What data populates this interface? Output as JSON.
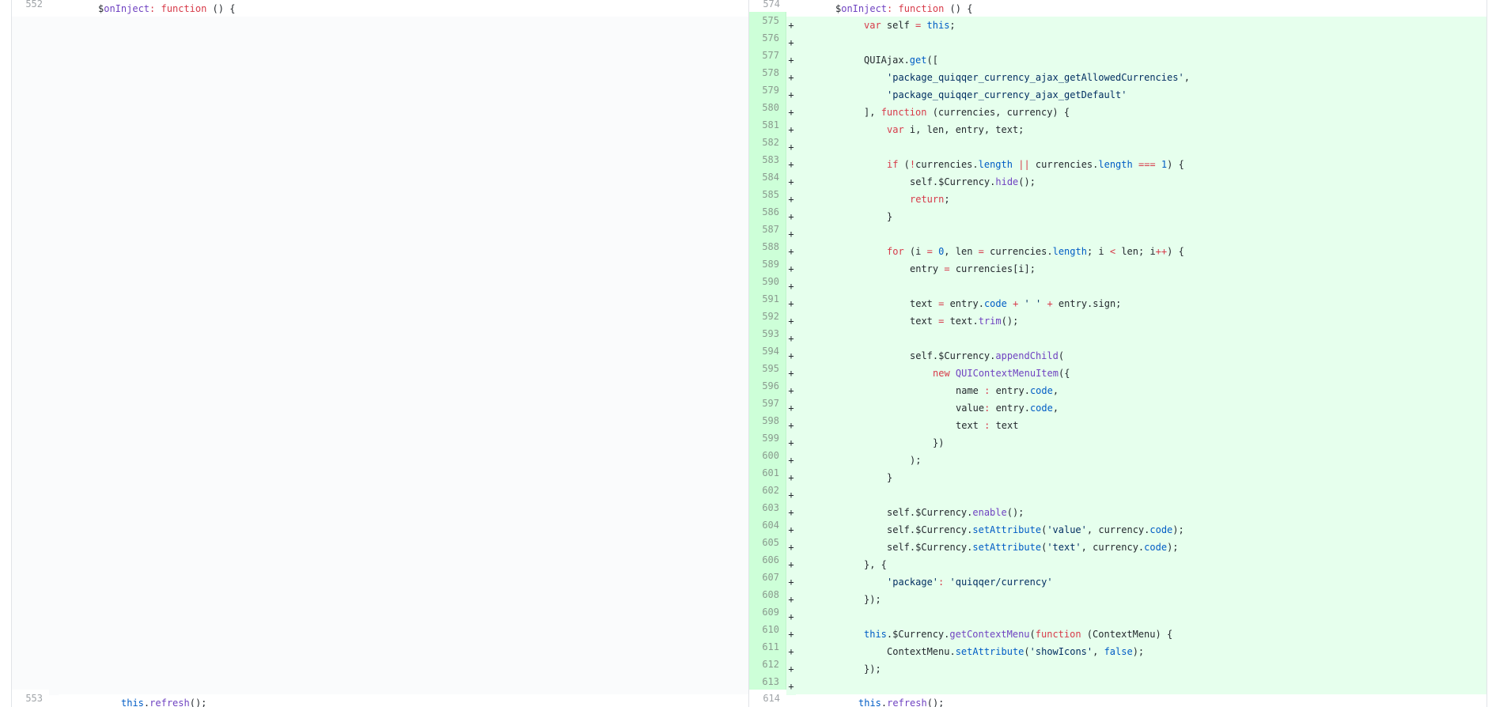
{
  "left": {
    "header": {
      "num": "552",
      "code": [
        [
          "",
          "$"
        ],
        [
          "f",
          "onInject"
        ],
        [
          "k",
          ":"
        ],
        [
          "",
          " "
        ],
        [
          "k",
          "function"
        ],
        [
          "",
          " () {"
        ]
      ]
    },
    "footer": {
      "num": "553",
      "code": [
        [
          "c",
          "this"
        ],
        [
          "",
          "."
        ],
        [
          "f",
          "refresh"
        ],
        [
          "",
          "();"
        ]
      ]
    }
  },
  "right": {
    "header": {
      "num": "574",
      "code": [
        [
          "",
          "$"
        ],
        [
          "f",
          "onInject"
        ],
        [
          "k",
          ":"
        ],
        [
          "",
          " "
        ],
        [
          "k",
          "function"
        ],
        [
          "",
          " () {"
        ]
      ]
    },
    "footer": {
      "num": "614",
      "code": [
        [
          "c",
          "this"
        ],
        [
          "",
          "."
        ],
        [
          "f",
          "refresh"
        ],
        [
          "",
          "();"
        ]
      ]
    },
    "lines": [
      {
        "num": "575",
        "indent": 2,
        "code": [
          [
            "k",
            "var"
          ],
          [
            "",
            " self "
          ],
          [
            "k",
            "="
          ],
          [
            "",
            " "
          ],
          [
            "c",
            "this"
          ],
          [
            "",
            ";"
          ]
        ]
      },
      {
        "num": "576",
        "indent": 0,
        "code": []
      },
      {
        "num": "577",
        "indent": 2,
        "code": [
          [
            "",
            "QUIAjax."
          ],
          [
            "c",
            "get"
          ],
          [
            "",
            "(["
          ]
        ]
      },
      {
        "num": "578",
        "indent": 3,
        "code": [
          [
            "s",
            "'package_quiqqer_currency_ajax_getAllowedCurrencies'"
          ],
          [
            "",
            ","
          ]
        ]
      },
      {
        "num": "579",
        "indent": 3,
        "code": [
          [
            "s",
            "'package_quiqqer_currency_ajax_getDefault'"
          ]
        ]
      },
      {
        "num": "580",
        "indent": 2,
        "code": [
          [
            "",
            "], "
          ],
          [
            "k",
            "function"
          ],
          [
            "",
            " (currencies, currency) {"
          ]
        ]
      },
      {
        "num": "581",
        "indent": 3,
        "code": [
          [
            "k",
            "var"
          ],
          [
            "",
            " i, len, entry, text;"
          ]
        ]
      },
      {
        "num": "582",
        "indent": 0,
        "code": []
      },
      {
        "num": "583",
        "indent": 3,
        "code": [
          [
            "k",
            "if"
          ],
          [
            "",
            " ("
          ],
          [
            "k",
            "!"
          ],
          [
            "",
            "currencies."
          ],
          [
            "c",
            "length"
          ],
          [
            "",
            " "
          ],
          [
            "k",
            "||"
          ],
          [
            "",
            " currencies."
          ],
          [
            "c",
            "length"
          ],
          [
            "",
            " "
          ],
          [
            "k",
            "==="
          ],
          [
            "",
            " "
          ],
          [
            "c",
            "1"
          ],
          [
            "",
            ") {"
          ]
        ]
      },
      {
        "num": "584",
        "indent": 4,
        "code": [
          [
            "",
            "self.$Currency."
          ],
          [
            "f",
            "hide"
          ],
          [
            "",
            "();"
          ]
        ]
      },
      {
        "num": "585",
        "indent": 4,
        "code": [
          [
            "k",
            "return"
          ],
          [
            "",
            ";"
          ]
        ]
      },
      {
        "num": "586",
        "indent": 3,
        "code": [
          [
            "",
            "}"
          ]
        ]
      },
      {
        "num": "587",
        "indent": 0,
        "code": []
      },
      {
        "num": "588",
        "indent": 3,
        "code": [
          [
            "k",
            "for"
          ],
          [
            "",
            " (i "
          ],
          [
            "k",
            "="
          ],
          [
            "",
            " "
          ],
          [
            "c",
            "0"
          ],
          [
            "",
            ", len "
          ],
          [
            "k",
            "="
          ],
          [
            "",
            " currencies."
          ],
          [
            "c",
            "length"
          ],
          [
            "",
            "; i "
          ],
          [
            "k",
            "<"
          ],
          [
            "",
            " len; i"
          ],
          [
            "k",
            "++"
          ],
          [
            "",
            ") {"
          ]
        ]
      },
      {
        "num": "589",
        "indent": 4,
        "code": [
          [
            "",
            "entry "
          ],
          [
            "k",
            "="
          ],
          [
            "",
            " currencies[i];"
          ]
        ]
      },
      {
        "num": "590",
        "indent": 0,
        "code": []
      },
      {
        "num": "591",
        "indent": 4,
        "code": [
          [
            "",
            "text "
          ],
          [
            "k",
            "="
          ],
          [
            "",
            " entry."
          ],
          [
            "c",
            "code"
          ],
          [
            "",
            " "
          ],
          [
            "k",
            "+"
          ],
          [
            "",
            " "
          ],
          [
            "s",
            "' '"
          ],
          [
            "",
            " "
          ],
          [
            "k",
            "+"
          ],
          [
            "",
            " entry.sign;"
          ]
        ]
      },
      {
        "num": "592",
        "indent": 4,
        "code": [
          [
            "",
            "text "
          ],
          [
            "k",
            "="
          ],
          [
            "",
            " text."
          ],
          [
            "f",
            "trim"
          ],
          [
            "",
            "();"
          ]
        ]
      },
      {
        "num": "593",
        "indent": 0,
        "code": []
      },
      {
        "num": "594",
        "indent": 4,
        "code": [
          [
            "",
            "self.$Currency."
          ],
          [
            "f",
            "appendChild"
          ],
          [
            "",
            "("
          ]
        ]
      },
      {
        "num": "595",
        "indent": 5,
        "code": [
          [
            "k",
            "new"
          ],
          [
            "",
            " "
          ],
          [
            "f",
            "QUIContextMenuItem"
          ],
          [
            "",
            "({"
          ]
        ]
      },
      {
        "num": "596",
        "indent": 6,
        "code": [
          [
            "",
            "name "
          ],
          [
            "k",
            ":"
          ],
          [
            "",
            " entry."
          ],
          [
            "c",
            "code"
          ],
          [
            "",
            ","
          ]
        ]
      },
      {
        "num": "597",
        "indent": 6,
        "code": [
          [
            "",
            "value"
          ],
          [
            "k",
            ":"
          ],
          [
            "",
            " entry."
          ],
          [
            "c",
            "code"
          ],
          [
            "",
            ","
          ]
        ]
      },
      {
        "num": "598",
        "indent": 6,
        "code": [
          [
            "",
            "text "
          ],
          [
            "k",
            ":"
          ],
          [
            "",
            " text"
          ]
        ]
      },
      {
        "num": "599",
        "indent": 5,
        "code": [
          [
            "",
            "})"
          ]
        ]
      },
      {
        "num": "600",
        "indent": 4,
        "code": [
          [
            "",
            ");"
          ]
        ]
      },
      {
        "num": "601",
        "indent": 3,
        "code": [
          [
            "",
            "}"
          ]
        ]
      },
      {
        "num": "602",
        "indent": 0,
        "code": []
      },
      {
        "num": "603",
        "indent": 3,
        "code": [
          [
            "",
            "self.$Currency."
          ],
          [
            "f",
            "enable"
          ],
          [
            "",
            "();"
          ]
        ]
      },
      {
        "num": "604",
        "indent": 3,
        "code": [
          [
            "",
            "self.$Currency."
          ],
          [
            "c",
            "setAttribute"
          ],
          [
            "",
            "("
          ],
          [
            "s",
            "'value'"
          ],
          [
            "",
            ", currency."
          ],
          [
            "c",
            "code"
          ],
          [
            "",
            ");"
          ]
        ]
      },
      {
        "num": "605",
        "indent": 3,
        "code": [
          [
            "",
            "self.$Currency."
          ],
          [
            "c",
            "setAttribute"
          ],
          [
            "",
            "("
          ],
          [
            "s",
            "'text'"
          ],
          [
            "",
            ", currency."
          ],
          [
            "c",
            "code"
          ],
          [
            "",
            ");"
          ]
        ]
      },
      {
        "num": "606",
        "indent": 2,
        "code": [
          [
            "",
            "}, {"
          ]
        ]
      },
      {
        "num": "607",
        "indent": 3,
        "code": [
          [
            "s",
            "'package'"
          ],
          [
            "k",
            ":"
          ],
          [
            "",
            " "
          ],
          [
            "s",
            "'quiqqer/currency'"
          ]
        ]
      },
      {
        "num": "608",
        "indent": 2,
        "code": [
          [
            "",
            "});"
          ]
        ]
      },
      {
        "num": "609",
        "indent": 0,
        "code": []
      },
      {
        "num": "610",
        "indent": 2,
        "code": [
          [
            "c",
            "this"
          ],
          [
            "",
            ".$Currency."
          ],
          [
            "f",
            "getContextMenu"
          ],
          [
            "",
            "("
          ],
          [
            "k",
            "function"
          ],
          [
            "",
            " (ContextMenu) {"
          ]
        ]
      },
      {
        "num": "611",
        "indent": 3,
        "code": [
          [
            "",
            "ContextMenu."
          ],
          [
            "c",
            "setAttribute"
          ],
          [
            "",
            "("
          ],
          [
            "s",
            "'showIcons'"
          ],
          [
            "",
            ", "
          ],
          [
            "c",
            "false"
          ],
          [
            "",
            ");"
          ]
        ]
      },
      {
        "num": "612",
        "indent": 2,
        "code": [
          [
            "",
            "});"
          ]
        ]
      },
      {
        "num": "613",
        "indent": 0,
        "code": []
      }
    ]
  }
}
